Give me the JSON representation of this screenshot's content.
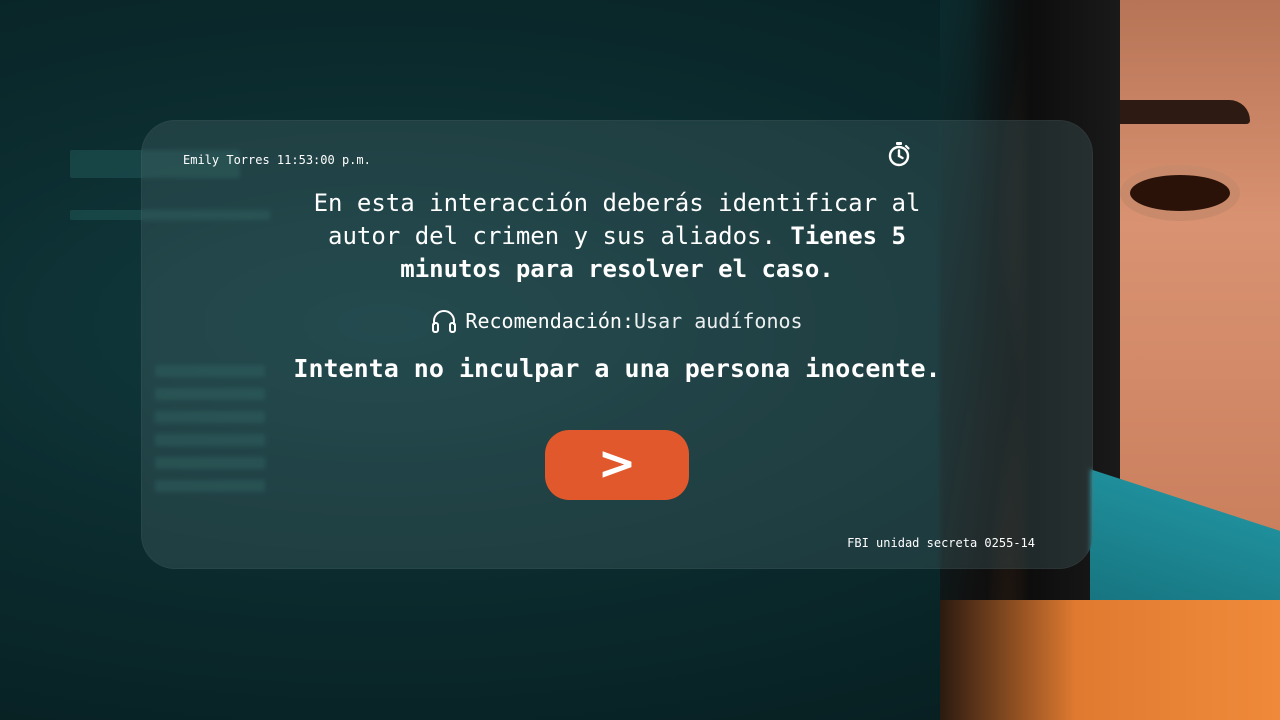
{
  "header": {
    "user_time": "Emily Torres 11:53:00 p.m.",
    "timer_icon": "stopwatch-icon"
  },
  "intro": {
    "text_regular": "En esta interacción deberás identificar al autor del crimen y sus aliados. ",
    "text_bold": "Tienes 5 minutos para resolver el caso."
  },
  "recommendation": {
    "icon": "headphones-icon",
    "label": "Recomendación",
    "separator": ":",
    "value": "Usar audífonos"
  },
  "warning": "Intenta no inculpar a una persona inocente.",
  "next_button": {
    "label": ">",
    "color": "#e0582b"
  },
  "footer": {
    "unit_id": "FBI unidad secreta 0255-14"
  }
}
